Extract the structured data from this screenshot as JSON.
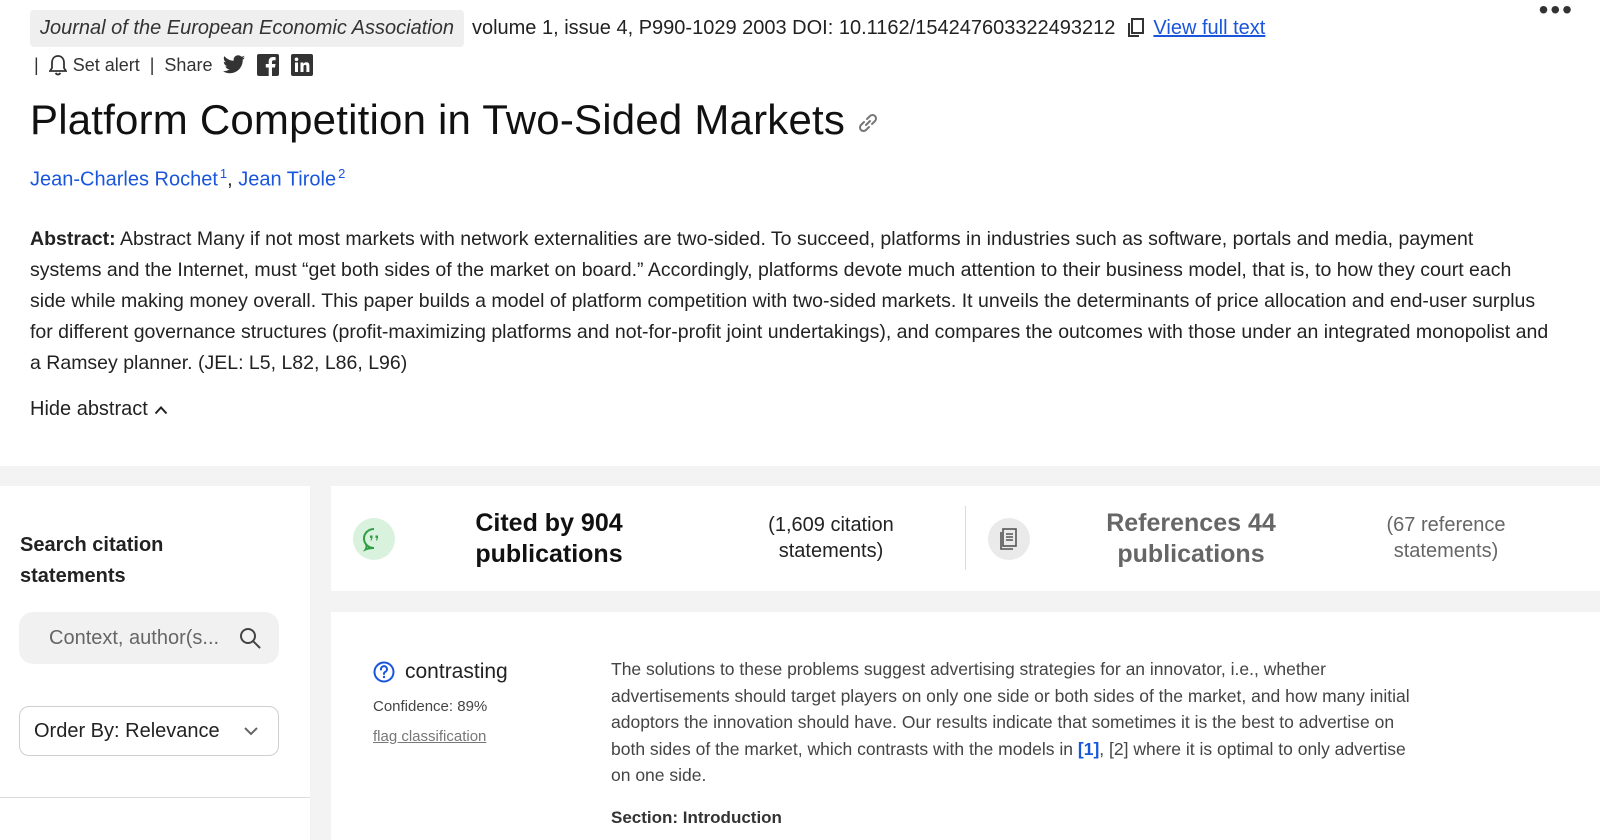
{
  "header": {
    "journal": "Journal of the European Economic Association",
    "meta": "volume 1, issue 4, P990-1029 2003 DOI: 10.1162/154247603322493212",
    "view_full_text": "View full text",
    "more_menu": "•••"
  },
  "actions": {
    "separator": "|",
    "set_alert": "Set alert",
    "share": "Share",
    "icons": [
      "bell-icon",
      "twitter-icon",
      "facebook-icon",
      "linkedin-icon"
    ]
  },
  "paper": {
    "title": "Platform Competition in Two-Sided Markets",
    "authors": [
      {
        "name": "Jean-Charles Rochet",
        "sup": "1"
      },
      {
        "name": "Jean Tirole",
        "sup": "2"
      }
    ],
    "author_separator": ",",
    "abstract_label": "Abstract:",
    "abstract_text": "Abstract Many if not most markets with network externalities are two-sided. To succeed, platforms in industries such as software, portals and media, payment systems and the Internet, must “get both sides of the market on board.” Accordingly, platforms devote much attention to their business model, that is, to how they court each side while making money overall. This paper builds a model of platform competition with two-sided markets. It unveils the determinants of price allocation and end-user surplus for different governance structures (profit-maximizing platforms and not-for-profit joint undertakings), and compares the outcomes with those under an integrated monopolist and a Ramsey planner. (JEL: L5, L82, L86, L96)",
    "hide_abstract": "Hide abstract"
  },
  "sidebar": {
    "search_label": "Search citation statements",
    "search_placeholder": "Context, author(s...",
    "order_by": "Order By: Relevance"
  },
  "stats": {
    "cited_by": "Cited by 904 publications",
    "citation_statements": "(1,609 citation statements)",
    "references": "References 44 publications",
    "reference_statements": "(67 reference statements)"
  },
  "citation": {
    "classification": "contrasting",
    "confidence": "Confidence: 89%",
    "flag": "flag classification",
    "snippet_before": "The solutions to these problems suggest advertising strategies for an innovator, i.e., whether advertisements should target players on only one side or both sides of the market, and how many initial adoptors the innovation should have. Our results indicate that sometimes it is the best to advertise on both sides of the market, which contrasts with the models in ",
    "ref1": "[1]",
    "ref_sep": ", ",
    "ref2": "[2]",
    "snippet_after": " where it is optimal to only advertise on one side.",
    "section": "Section: Introduction"
  },
  "colors": {
    "link_blue": "#1a56db",
    "cited_icon_bg": "#d9f2dd",
    "cited_icon_fg": "#2f9e44",
    "band_gray": "#f3f3f3"
  }
}
